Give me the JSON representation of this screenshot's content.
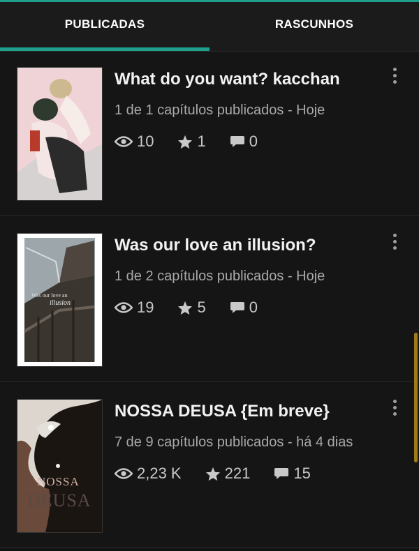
{
  "tabs": [
    {
      "label": "PUBLICADAS",
      "active": true
    },
    {
      "label": "RASCUNHOS",
      "active": false
    }
  ],
  "stories": [
    {
      "title": "What do you want? kacchan",
      "subtitle": "1 de 1 capítulos publicados - Hoje",
      "views": "10",
      "stars": "1",
      "comments": "0",
      "cover_text": []
    },
    {
      "title": "Was our love an illusion?",
      "subtitle": "1 de 2 capítulos publicados - Hoje",
      "views": "19",
      "stars": "5",
      "comments": "0",
      "cover_text": [
        "Was our love an",
        "illusion"
      ]
    },
    {
      "title": "NOSSA DEUSA {Em breve}",
      "subtitle": "7 de 9 capítulos publicados - há 4 dias",
      "views": "2,23 K",
      "stars": "221",
      "comments": "15",
      "cover_text": [
        "NOSSA",
        "DEUSA"
      ]
    }
  ],
  "colors": {
    "accent": "#1fa08f",
    "background": "#141414",
    "scrollbar": "#a07a1a"
  },
  "icons": [
    "eye-icon",
    "star-icon",
    "comment-icon",
    "more-vertical-icon"
  ]
}
